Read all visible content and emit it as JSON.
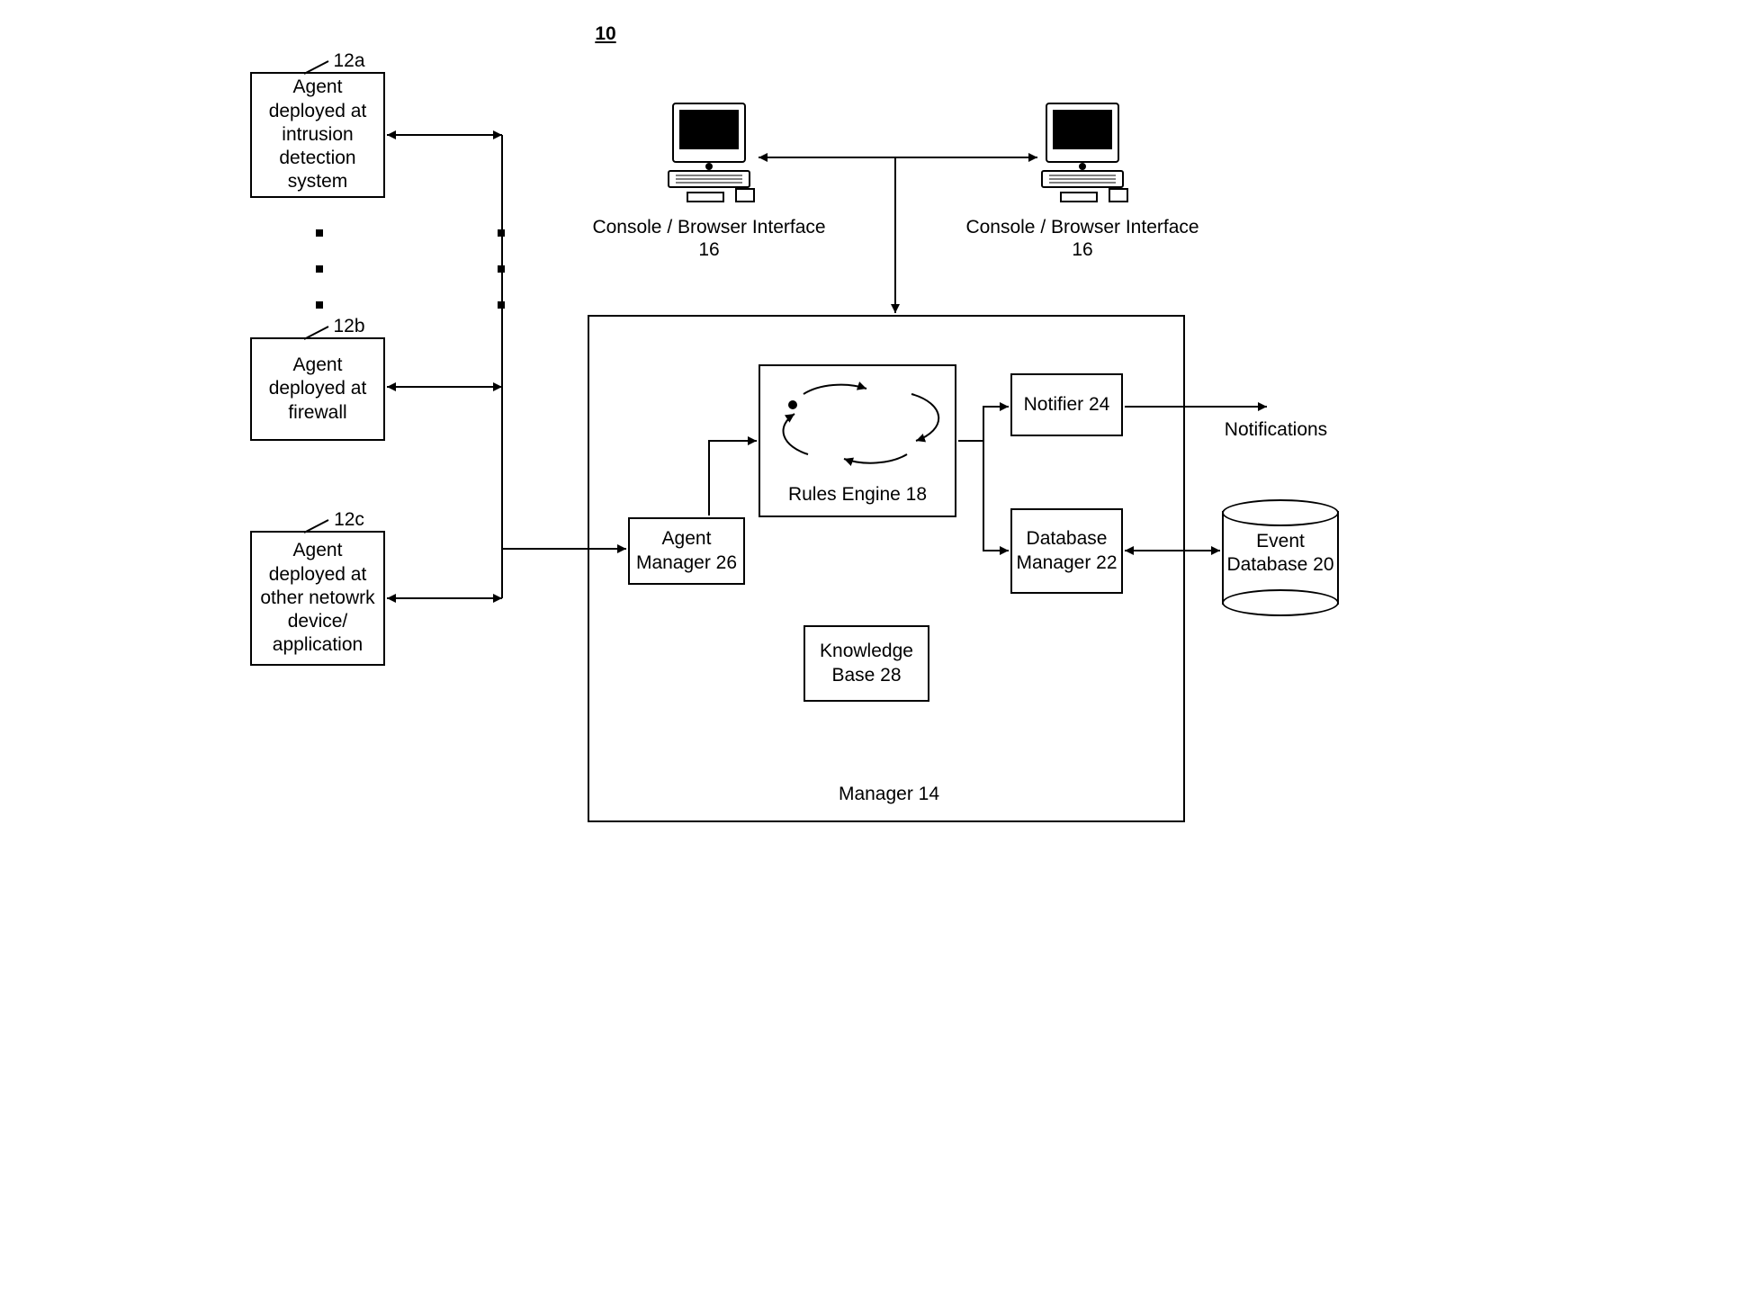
{
  "figure_ref": "10",
  "agents": {
    "a": {
      "ref": "12a",
      "text": "Agent\ndeployed at\nintrusion\ndetection\nsystem"
    },
    "b": {
      "ref": "12b",
      "text": "Agent\ndeployed at\nfirewall"
    },
    "c": {
      "ref": "12c",
      "text": "Agent\ndeployed at\nother netowrk\ndevice/\napplication"
    }
  },
  "consoles": {
    "left": {
      "label": "Console / Browser Interface",
      "ref": "16"
    },
    "right": {
      "label": "Console / Browser Interface",
      "ref": "16"
    }
  },
  "manager": {
    "label": "Manager 14",
    "agent_manager": "Agent\nManager 26",
    "rules_engine": "Rules Engine 18",
    "knowledge_base": "Knowledge\nBase 28",
    "notifier": "Notifier\n24",
    "db_manager": "Database\nManager\n22"
  },
  "outputs": {
    "notifications": "Notifications",
    "event_db": "Event\nDatabase\n20"
  }
}
